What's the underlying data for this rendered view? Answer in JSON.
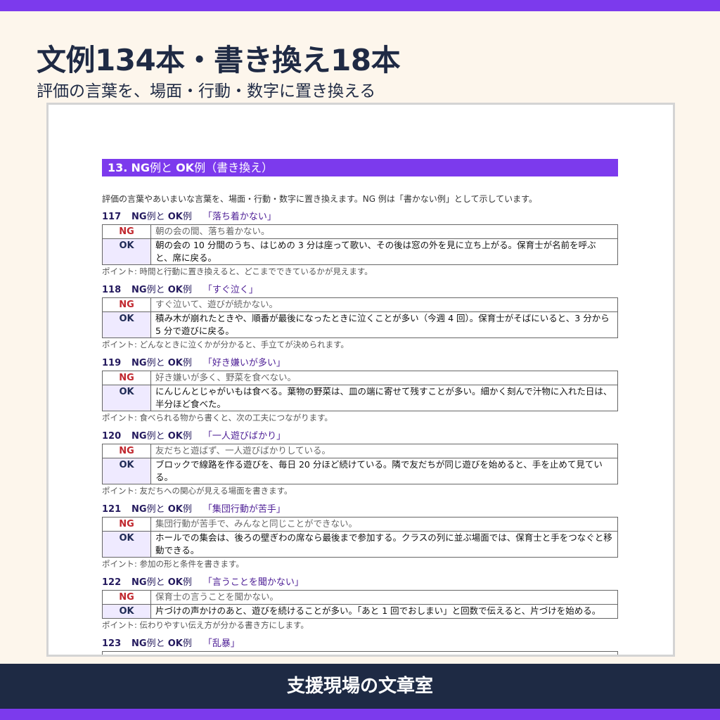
{
  "header": {
    "title": "文例134本・書き換え18本",
    "subtitle": "評価の言葉を、場面・行動・数字に置き換える"
  },
  "section": {
    "number": "13.",
    "ng_label": "NG",
    "example_word": "例と",
    "ok_label": "OK",
    "title_suffix": "例（書き換え）",
    "intro": "評価の言葉やあいまいな言葉を、場面・行動・数字に置き換えます。NG 例は「書かない例」として示しています。"
  },
  "entries": [
    {
      "no": "117",
      "head_ng": "NG",
      "head_mid": "例と",
      "head_ok": "OK",
      "head_end": "例",
      "topic": "「落ち着かない」",
      "ng_label": "NG",
      "ng_text": "朝の会の間、落ち着かない。",
      "ok_label": "OK",
      "ok_text": "朝の会の 10 分間のうち、はじめの 3 分は座って歌い、その後は窓の外を見に立ち上がる。保育士が名前を呼ぶと、席に戻る。",
      "point": "ポイント: 時間と行動に置き換えると、どこまでできているかが見えます。"
    },
    {
      "no": "118",
      "head_ng": "NG",
      "head_mid": "例と",
      "head_ok": "OK",
      "head_end": "例",
      "topic": "「すぐ泣く」",
      "ng_label": "NG",
      "ng_text": "すぐ泣いて、遊びが続かない。",
      "ok_label": "OK",
      "ok_text": "積み木が崩れたときや、順番が最後になったときに泣くことが多い（今週 4 回）。保育士がそばにいると、3 分から 5 分で遊びに戻る。",
      "point": "ポイント: どんなときに泣くかが分かると、手立てが決められます。"
    },
    {
      "no": "119",
      "head_ng": "NG",
      "head_mid": "例と",
      "head_ok": "OK",
      "head_end": "例",
      "topic": "「好き嫌いが多い」",
      "ng_label": "NG",
      "ng_text": "好き嫌いが多く、野菜を食べない。",
      "ok_label": "OK",
      "ok_text": "にんじんとじゃがいもは食べる。葉物の野菜は、皿の端に寄せて残すことが多い。細かく刻んで汁物に入れた日は、半分ほど食べた。",
      "point": "ポイント: 食べられる物から書くと、次の工夫につながります。"
    },
    {
      "no": "120",
      "head_ng": "NG",
      "head_mid": "例と",
      "head_ok": "OK",
      "head_end": "例",
      "topic": "「一人遊びばかり」",
      "ng_label": "NG",
      "ng_text": "友だちと遊ばず、一人遊びばかりしている。",
      "ok_label": "OK",
      "ok_text": "ブロックで線路を作る遊びを、毎日 20 分ほど続けている。隣で友だちが同じ遊びを始めると、手を止めて見ている。",
      "point": "ポイント: 友だちへの関心が見える場面を書きます。"
    },
    {
      "no": "121",
      "head_ng": "NG",
      "head_mid": "例と",
      "head_ok": "OK",
      "head_end": "例",
      "topic": "「集団行動が苦手」",
      "ng_label": "NG",
      "ng_text": "集団行動が苦手で、みんなと同じことができない。",
      "ok_label": "OK",
      "ok_text": "ホールでの集会は、後ろの壁ぎわの席なら最後まで参加する。クラスの列に並ぶ場面では、保育士と手をつなぐと移動できる。",
      "point": "ポイント: 参加の形と条件を書きます。"
    },
    {
      "no": "122",
      "head_ng": "NG",
      "head_mid": "例と",
      "head_ok": "OK",
      "head_end": "例",
      "topic": "「言うことを聞かない」",
      "ng_label": "NG",
      "ng_text": "保育士の言うことを聞かない。",
      "ok_label": "OK",
      "ok_text": "片づけの声かけのあと、遊びを続けることが多い。「あと 1 回でおしまい」と回数で伝えると、片づけを始める。",
      "point": "ポイント: 伝わりやすい伝え方が分かる書き方にします。"
    },
    {
      "no": "123",
      "head_ng": "NG",
      "head_mid": "例と",
      "head_ok": "OK",
      "head_end": "例",
      "topic": "「乱暴」"
    }
  ],
  "footer": {
    "brand": "支援現場の文章室"
  },
  "colors": {
    "accent": "#7c3aed",
    "navy": "#1e2a44",
    "background": "#fdf6ec",
    "ng_red": "#c0262d",
    "ok_cell": "#efeaff"
  }
}
